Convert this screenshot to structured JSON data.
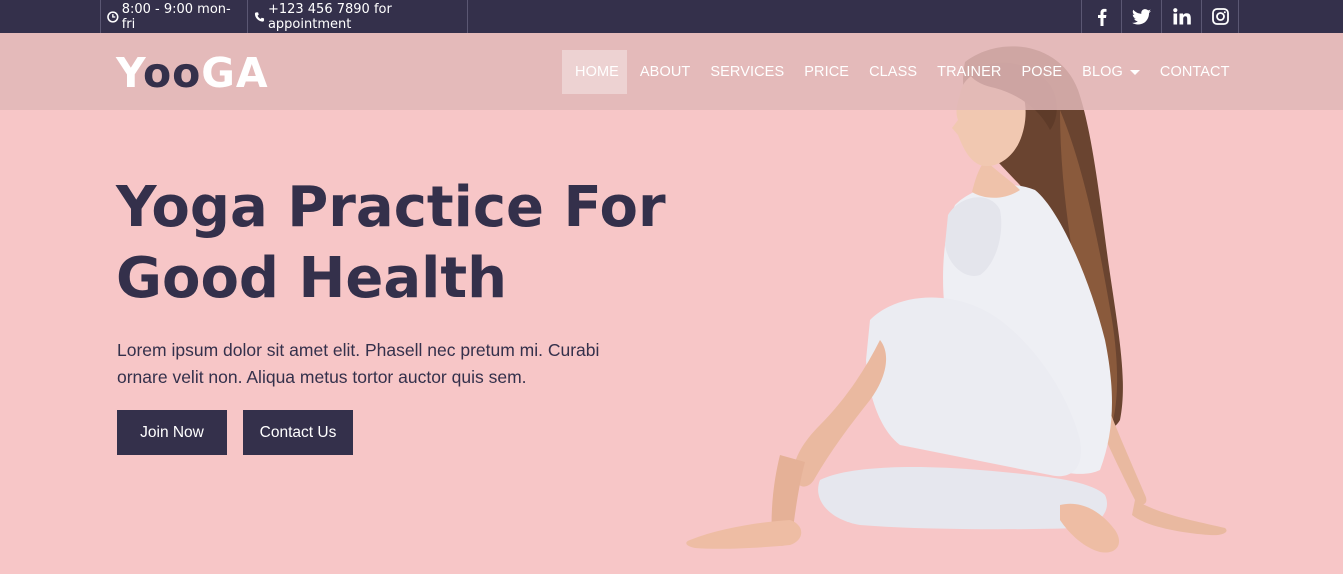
{
  "topbar": {
    "hours": "8:00 - 9:00 mon-fri",
    "phone": "+123 456 7890 for appointment",
    "social": [
      {
        "icon": "facebook-icon"
      },
      {
        "icon": "twitter-icon"
      },
      {
        "icon": "linkedin-icon"
      },
      {
        "icon": "instagram-icon"
      }
    ]
  },
  "logo": {
    "part1": "Y",
    "part2": "oo",
    "part3": "GA"
  },
  "nav": {
    "items": [
      "HOME",
      "ABOUT",
      "SERVICES",
      "PRICE",
      "CLASS",
      "TRAINER",
      "POSE",
      "BLOG",
      "CONTACT"
    ],
    "active": "HOME"
  },
  "hero": {
    "title_line1": "Yoga Practice For",
    "title_line2": "Good Health",
    "text": "Lorem ipsum dolor sit amet elit. Phasell nec pretum mi. Curabi ornare velit non. Aliqua metus tortor auctor quis sem.",
    "join_label": "Join Now",
    "contact_label": "Contact Us"
  },
  "colors": {
    "dark": "#34304b",
    "background": "#f7c6c7",
    "navbar": "#e0b7b7"
  }
}
